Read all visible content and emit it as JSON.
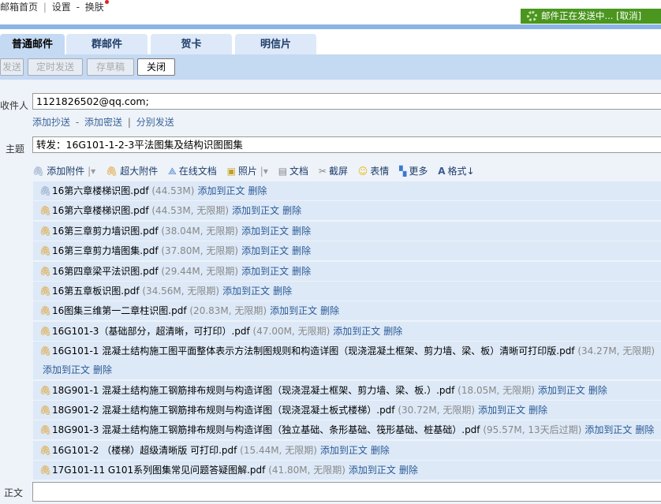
{
  "top_links": {
    "home": "邮箱首页",
    "sep": "|",
    "settings": "设置",
    "dash": "-",
    "skin": "换肤"
  },
  "status": {
    "text": "邮件正在发送中...",
    "cancel": "[取消]"
  },
  "tabs": [
    "普通邮件",
    "群邮件",
    "贺卡",
    "明信片"
  ],
  "toolbar": {
    "send": "发送",
    "scheduled": "定时发送",
    "draft": "存草稿",
    "close": "关闭"
  },
  "recipient": {
    "label": "收件人",
    "value": "1121826502@qq.com;"
  },
  "recipient_links": {
    "cc": "添加抄送",
    "dash": "-",
    "bcc": "添加密送",
    "sep": "|",
    "separate": "分别发送"
  },
  "subject": {
    "label": "主题",
    "value": "转发：16G101-1-2-3平法图集及结构识图图集"
  },
  "attach_toolbar": [
    {
      "icon": "paperclip-icon",
      "label": "添加附件",
      "dropdown": true
    },
    {
      "icon": "large-attachment-icon",
      "label": "超大附件"
    },
    {
      "icon": "online-doc-icon",
      "label": "在线文档"
    },
    {
      "icon": "photo-icon",
      "label": "照片",
      "dropdown": true
    },
    {
      "icon": "document-icon",
      "label": "文档"
    },
    {
      "icon": "screenshot-icon",
      "label": "截屏"
    },
    {
      "icon": "emoji-icon",
      "label": "表情"
    },
    {
      "icon": "more-icon",
      "label": "更多"
    },
    {
      "icon": "format-icon",
      "label": "格式↓"
    }
  ],
  "attachments": [
    {
      "name": "16第六章楼梯识图.pdf",
      "meta": "(44.53M)",
      "add": "添加到正文",
      "del": "删除",
      "type": "normal"
    },
    {
      "name": "16第六章楼梯识图.pdf",
      "meta": "(44.53M, 无限期)",
      "add": "添加到正文",
      "del": "删除",
      "type": "large"
    },
    {
      "name": "16第三章剪力墙识图.pdf",
      "meta": "(38.04M, 无限期)",
      "add": "添加到正文",
      "del": "删除",
      "type": "large"
    },
    {
      "name": "16第三章剪力墙图集.pdf",
      "meta": "(37.80M, 无限期)",
      "add": "添加到正文",
      "del": "删除",
      "type": "large"
    },
    {
      "name": "16第四章梁平法识图.pdf",
      "meta": "(29.44M, 无限期)",
      "add": "添加到正文",
      "del": "删除",
      "type": "large"
    },
    {
      "name": "16第五章板识图.pdf",
      "meta": "(34.56M, 无限期)",
      "add": "添加到正文",
      "del": "删除",
      "type": "large"
    },
    {
      "name": "16图集三维第一二章柱识图.pdf",
      "meta": "(20.83M, 无限期)",
      "add": "添加到正文",
      "del": "删除",
      "type": "large"
    },
    {
      "name": "16G101-3（基础部分，超清晰，可打印）.pdf",
      "meta": "(47.00M, 无限期)",
      "add": "添加到正文",
      "del": "删除",
      "type": "large"
    },
    {
      "name": "16G101-1 混凝土结构施工图平面整体表示方法制图规则和构造详图（现浇混凝土框架、剪力墙、梁、板）清晰可打印版.pdf",
      "meta": "(34.27M, 无限期)",
      "add": "添加到正文",
      "del": "删除",
      "type": "large"
    },
    {
      "name": "18G901-1 混凝土结构施工钢筋排布规则与构造详图（现浇混凝土框架、剪力墙、梁、板.）.pdf",
      "meta": "(18.05M, 无限期)",
      "add": "添加到正文",
      "del": "删除",
      "type": "large"
    },
    {
      "name": "18G901-2 混凝土结构施工钢筋排布规则与构造详图（现浇混凝土板式楼梯）.pdf",
      "meta": "(30.72M, 无限期)",
      "add": "添加到正文",
      "del": "删除",
      "type": "large"
    },
    {
      "name": "18G901-3 混凝土结构施工钢筋排布规则与构造详图（独立基础、条形基础、筏形基础、桩基础）.pdf",
      "meta": "(95.57M, 13天后过期)",
      "add": "添加到正文",
      "del": "删除",
      "type": "large"
    },
    {
      "name": "16G101-2 （楼梯）超级清晰版 可打印.pdf",
      "meta": "(15.44M, 无限期)",
      "add": "添加到正文",
      "del": "删除",
      "type": "large"
    },
    {
      "name": "17G101-11 G101系列图集常见问题答疑图解.pdf",
      "meta": "(41.80M, 无限期)",
      "add": "添加到正文",
      "del": "删除",
      "type": "large"
    }
  ],
  "body": {
    "label": "正文"
  }
}
